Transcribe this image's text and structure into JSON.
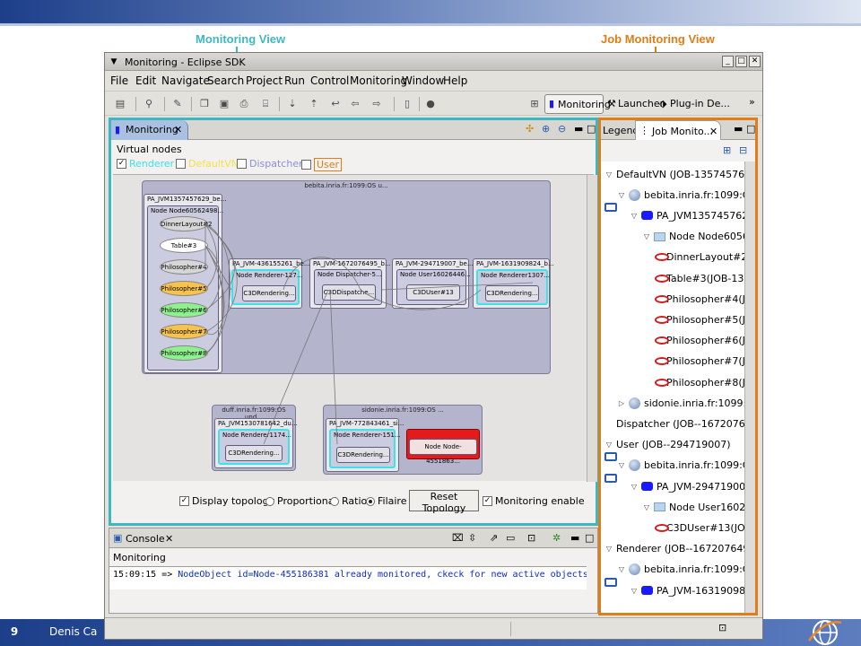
{
  "slide": {
    "number": "9",
    "author": "Denis Ca",
    "callout_monitoring": "Monitoring View",
    "callout_job": "Job Monitoring View",
    "colors": {
      "monitoring": "#3fb7c3",
      "job": "#e07d17",
      "band": "#1d3f8a"
    }
  },
  "window": {
    "title": "Monitoring - Eclipse SDK",
    "menu": [
      "File",
      "Edit",
      "Navigate",
      "Search",
      "Project",
      "Run",
      "Control",
      "Monitoring",
      "Window",
      "Help"
    ],
    "perspectives": {
      "monitoring": "Monitoring",
      "launcher": "Launcher",
      "plugin": "Plug-in De...",
      "more": "»"
    }
  },
  "monitoring": {
    "tab": "Monitoring",
    "virtual_nodes_label": "Virtual nodes",
    "vn_filters": [
      {
        "label": "Renderer",
        "checked": true,
        "color": "#3de3e8"
      },
      {
        "label": "DefaultVN",
        "checked": false,
        "color": "#f4e04d"
      },
      {
        "label": "Dispatcher",
        "checked": false,
        "color": "#8a8fd8"
      },
      {
        "label": "User",
        "checked": false,
        "color": "#e07d17"
      }
    ],
    "hosts": {
      "bebita": "bebita.inria.fr:1099:OS u...",
      "duff": "duff.inria.fr:1099:OS und...",
      "sidonie": "sidonie.inria.fr:1099:OS ..."
    },
    "jvms": {
      "bebita_main": "PA_JVM1357457629_be...",
      "j436": "PA_JVM-436155261_be...",
      "j1672": "PA_JVM-1672076495_b...",
      "j2947": "PA_JVM-294719007_be...",
      "j1631": "PA_JVM-1631909824_b...",
      "duff": "PA_JVM1530781642_du...",
      "sidonie": "PA_JVM-772843461_si..."
    },
    "nodes": {
      "main": "Node Node60562498...",
      "renderer127": "Node Renderer-127...",
      "dispatcher5": "Node Dispatcher-5...",
      "user1602": "Node User16026446...",
      "renderer1307": "Node Renderer1307...",
      "renderer1174": "Node Renderer1174...",
      "renderer151": "Node Renderer-151...",
      "node4551": "Node Node-4551863..."
    },
    "objects": {
      "dinner": "DinnerLayout#2",
      "table": "Table#3",
      "p4": "Philosopher#4",
      "p5": "Philosopher#5",
      "p6": "Philosopher#6",
      "p7": "Philosopher#7",
      "p8": "Philosopher#8",
      "c3d_r1": "C3DRendering...",
      "c3d_disp": "C3DDispatche...",
      "c3d_user": "C3DUser#13",
      "c3d_r2": "C3DRendering...",
      "c3d_r3": "C3DRendering...",
      "c3d_r4": "C3DRendering..."
    },
    "options": {
      "display_topology": "Display topology",
      "proportional": "Proportional",
      "ratio": "Ratio",
      "filaire": "Filaire",
      "reset": "Reset Topology",
      "monitoring_enable": "Monitoring enable"
    }
  },
  "console": {
    "tab": "Console",
    "subtitle": "Monitoring",
    "time": "15:09:15 => ",
    "message": "NodeObject id=Node-455186381 already monitored, ckeck for new active objects"
  },
  "job": {
    "legend_tab": "Legend",
    "tab": "Job Monito...",
    "tree": [
      {
        "text": "DefaultVN (JOB-1357457629",
        "indent": 0,
        "icon": "vn",
        "tw": "open"
      },
      {
        "text": "bebita.inria.fr:1099:OS un",
        "indent": 1,
        "icon": "host",
        "tw": "open"
      },
      {
        "text": "PA_JVM1357457629_",
        "indent": 2,
        "icon": "jvm",
        "tw": "open"
      },
      {
        "text": "Node Node6056249",
        "indent": 3,
        "icon": "node",
        "tw": "open"
      },
      {
        "text": "DinnerLayout#2(",
        "indent": 4,
        "icon": "ao",
        "tw": ""
      },
      {
        "text": "Table#3(JOB-13",
        "indent": 4,
        "icon": "ao",
        "tw": ""
      },
      {
        "text": "Philosopher#4(J",
        "indent": 4,
        "icon": "ao",
        "tw": ""
      },
      {
        "text": "Philosopher#5(J",
        "indent": 4,
        "icon": "ao",
        "tw": ""
      },
      {
        "text": "Philosopher#6(J",
        "indent": 4,
        "icon": "ao",
        "tw": ""
      },
      {
        "text": "Philosopher#7(J",
        "indent": 4,
        "icon": "ao",
        "tw": ""
      },
      {
        "text": "Philosopher#8(J",
        "indent": 4,
        "icon": "ao",
        "tw": ""
      },
      {
        "text": "sidonie.inria.fr:1099:OS u",
        "indent": 1,
        "icon": "host",
        "tw": "closed"
      },
      {
        "text": "Dispatcher (JOB--167207649",
        "indent": 0,
        "icon": "vn",
        "tw": ""
      },
      {
        "text": "User (JOB--294719007)",
        "indent": 0,
        "icon": "vn",
        "tw": "open"
      },
      {
        "text": "bebita.inria.fr:1099:OS un",
        "indent": 1,
        "icon": "host",
        "tw": "open"
      },
      {
        "text": "PA_JVM-294719007_",
        "indent": 2,
        "icon": "jvm",
        "tw": "open"
      },
      {
        "text": "Node User1602644",
        "indent": 3,
        "icon": "node",
        "tw": "open"
      },
      {
        "text": "C3DUser#13(JO",
        "indent": 4,
        "icon": "ao",
        "tw": ""
      },
      {
        "text": "Renderer (JOB--1672076495",
        "indent": 0,
        "icon": "vn",
        "tw": "open"
      },
      {
        "text": "bebita.inria.fr:1099:OS un",
        "indent": 1,
        "icon": "host",
        "tw": "open"
      },
      {
        "text": "PA_JVM-1631909824,",
        "indent": 2,
        "icon": "jvm",
        "tw": "open"
      }
    ]
  }
}
